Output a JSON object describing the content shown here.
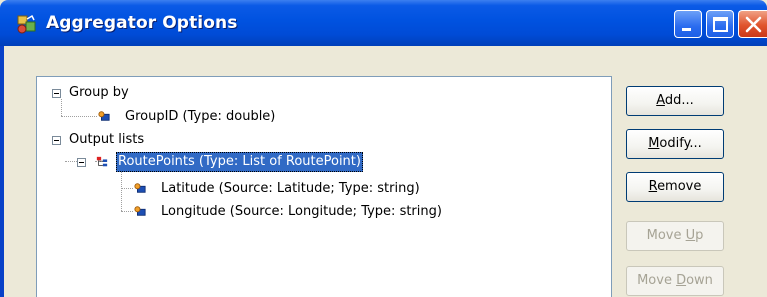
{
  "window": {
    "title": "Aggregator Options",
    "icon": "aggregator-app-icon",
    "controls": [
      "minimize-icon",
      "maximize-icon",
      "close-icon"
    ]
  },
  "tree": {
    "items": [
      {
        "label": "Group by",
        "expanded": true,
        "icon": "none"
      },
      {
        "label": "GroupID (Type: double)",
        "icon": "field-icon"
      },
      {
        "label": "Output lists",
        "expanded": true,
        "icon": "none"
      },
      {
        "label": "RoutePoints (Type: List of RoutePoint)",
        "expanded": true,
        "selected": true,
        "icon": "list-icon"
      },
      {
        "label": "Latitude (Source: Latitude; Type: string)",
        "icon": "field-icon"
      },
      {
        "label": "Longitude (Source: Longitude; Type: string)",
        "icon": "field-icon"
      }
    ]
  },
  "buttons": {
    "add": {
      "pre": "",
      "acc": "A",
      "post": "dd...",
      "enabled": true
    },
    "modify": {
      "pre": "",
      "acc": "M",
      "post": "odify...",
      "enabled": true
    },
    "remove": {
      "pre": "",
      "acc": "R",
      "post": "emove",
      "enabled": true
    },
    "move_up": {
      "pre": "Move ",
      "acc": "U",
      "post": "p",
      "enabled": false
    },
    "move_down": {
      "pre": "Move ",
      "acc": "D",
      "post": "own",
      "enabled": false
    }
  },
  "colors": {
    "titlebar": "#0052e0",
    "selection": "#316ac5",
    "dialog_bg": "#ece9d8"
  }
}
